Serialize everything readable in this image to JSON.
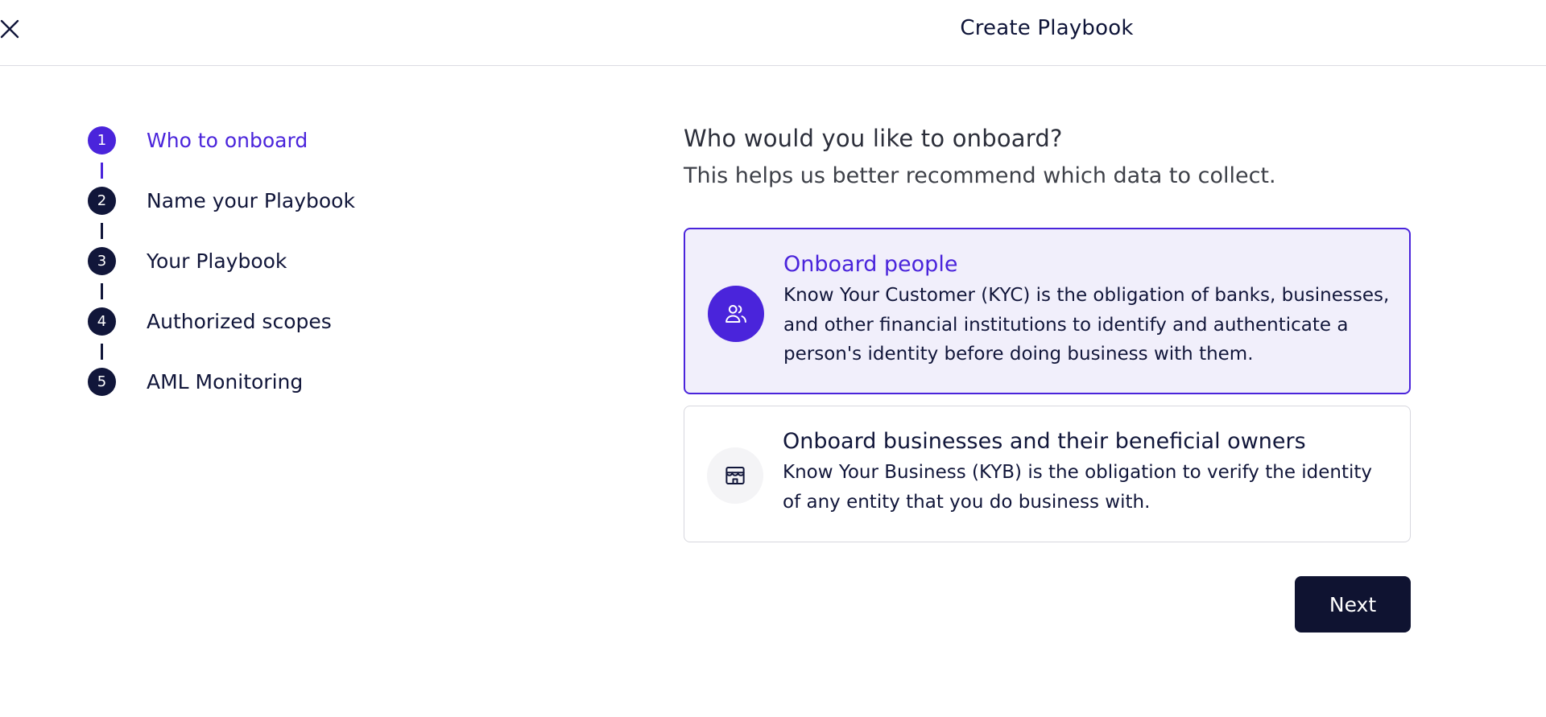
{
  "header": {
    "title": "Create Playbook",
    "close_icon": "close-icon"
  },
  "stepper": {
    "active_step": 1,
    "steps": [
      {
        "number": "1",
        "label": "Who to onboard"
      },
      {
        "number": "2",
        "label": "Name your Playbook"
      },
      {
        "number": "3",
        "label": "Your Playbook"
      },
      {
        "number": "4",
        "label": "Authorized scopes"
      },
      {
        "number": "5",
        "label": "AML Monitoring"
      }
    ]
  },
  "main": {
    "title": "Who would you like to onboard?",
    "subtitle": "This helps us better recommend which data to collect.",
    "options": [
      {
        "title": "Onboard people",
        "description": "Know Your Customer (KYC) is the obligation of banks, businesses, and other financial institutions to identify and authenticate a person's identity before doing business with them.",
        "icon": "users-icon",
        "selected": true
      },
      {
        "title": "Onboard businesses and their beneficial owners",
        "description": "Know Your Business (KYB) is the obligation to verify the identity of any entity that you do business with.",
        "icon": "store-icon",
        "selected": false
      }
    ],
    "next_label": "Next"
  },
  "colors": {
    "accent": "#4a24db",
    "dark": "#0f1331",
    "selected_bg": "#f1effb"
  }
}
